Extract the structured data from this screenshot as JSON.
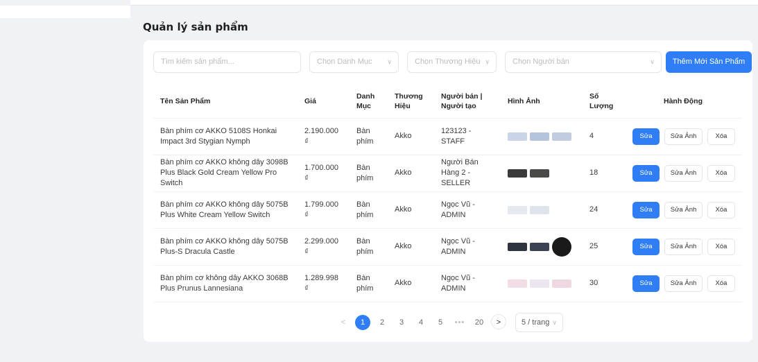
{
  "page": {
    "title": "Quản lý sản phẩm"
  },
  "filters": {
    "search_placeholder": "Tìm kiếm sản phẩm...",
    "category_placeholder": "Chọn Danh Mục",
    "brand_placeholder": "Chọn Thương Hiệu",
    "seller_placeholder": "Chọn Người bán",
    "add_button": "Thêm Mới Sản Phẩm"
  },
  "table": {
    "headers": {
      "name": "Tên Sản Phẩm",
      "price": "Giá",
      "category": "Danh Mục",
      "brand": "Thương Hiệu",
      "seller": "Người bán | Người tạo",
      "images": "Hình Ảnh",
      "quantity": "Số Lượng",
      "actions": "Hành Động"
    },
    "rows": [
      {
        "name": "Bàn phím cơ AKKO 5108S Honkai Impact 3rd Stygian Nymph",
        "price": "2.190.000 ₫",
        "category": "Bàn phím",
        "brand": "Akko",
        "seller": "123123 - STAFF",
        "quantity": "4",
        "thumb_colors": [
          "#c9d4e8",
          "#b6c3dc",
          "#c2cce0"
        ]
      },
      {
        "name": "Bàn phím cơ AKKO không dây 3098B Plus Black Gold Cream Yellow Pro Switch",
        "price": "1.700.000 ₫",
        "category": "Bàn phím",
        "brand": "Akko",
        "seller": "Người Bán Hàng 2 - SELLER",
        "quantity": "18",
        "thumb_colors": [
          "#3a3a3a",
          "#4a4a48"
        ]
      },
      {
        "name": "Bàn phím cơ AKKO không dây 5075B Plus White Cream Yellow Switch",
        "price": "1.799.000 ₫",
        "category": "Bàn phím",
        "brand": "Akko",
        "seller": "Ngọc Vũ - ADMIN",
        "quantity": "24",
        "thumb_colors": [
          "#e6e9f0",
          "#dfe3ec"
        ]
      },
      {
        "name": "Bàn phím cơ AKKO không dây 5075B Plus-S Dracula Castle",
        "price": "2.299.000 ₫",
        "category": "Bàn phím",
        "brand": "Akko",
        "seller": "Ngọc Vũ - ADMIN",
        "quantity": "25",
        "thumb_colors": [
          "#2e3440",
          "#3b4252",
          "#1a1a1a"
        ]
      },
      {
        "name": "Bàn phím cơ không dây AKKO 3068B Plus Prunus Lannesiana",
        "price": "1.289.998 ₫",
        "category": "Bàn phím",
        "brand": "Akko",
        "seller": "Ngọc Vũ - ADMIN",
        "quantity": "30",
        "thumb_colors": [
          "#f2dde6",
          "#ece6f0",
          "#f0d8e2"
        ]
      }
    ],
    "actions": {
      "edit": "Sửa",
      "edit_image": "Sửa Ảnh",
      "delete": "Xóa"
    }
  },
  "pagination": {
    "prev": "<",
    "pages": [
      "1",
      "2",
      "3",
      "4",
      "5"
    ],
    "ellipsis": "•••",
    "last": "20",
    "next": ">",
    "current": "1",
    "page_size": "5 / trang"
  },
  "colors": {
    "primary": "#2f7ef5",
    "background": "#f0f2f5"
  }
}
